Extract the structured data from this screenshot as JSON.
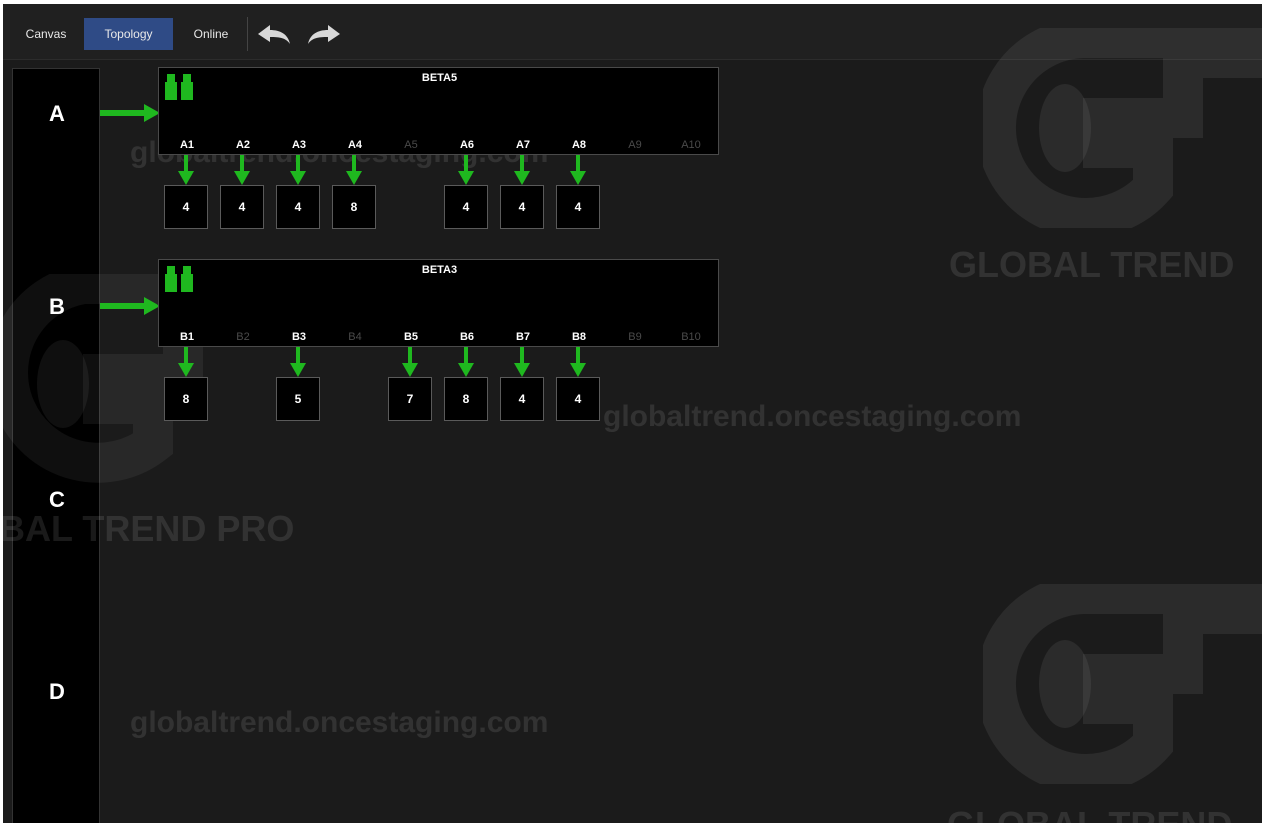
{
  "toolbar": {
    "tabs": [
      {
        "label": "Canvas",
        "active": false
      },
      {
        "label": "Topology",
        "active": true
      },
      {
        "label": "Online",
        "active": false
      }
    ],
    "undo_icon": "undo-arrow-icon",
    "redo_icon": "redo-arrow-icon"
  },
  "rail": {
    "labels": [
      "A",
      "B",
      "C",
      "D"
    ]
  },
  "devices": [
    {
      "name": "BETA5",
      "ports": [
        {
          "label": "A1",
          "active": true,
          "value": "4"
        },
        {
          "label": "A2",
          "active": true,
          "value": "4"
        },
        {
          "label": "A3",
          "active": true,
          "value": "4"
        },
        {
          "label": "A4",
          "active": true,
          "value": "8"
        },
        {
          "label": "A5",
          "active": false,
          "value": ""
        },
        {
          "label": "A6",
          "active": true,
          "value": "4"
        },
        {
          "label": "A7",
          "active": true,
          "value": "4"
        },
        {
          "label": "A8",
          "active": true,
          "value": "4"
        },
        {
          "label": "A9",
          "active": false,
          "value": ""
        },
        {
          "label": "A10",
          "active": false,
          "value": ""
        }
      ]
    },
    {
      "name": "BETA3",
      "ports": [
        {
          "label": "B1",
          "active": true,
          "value": "8"
        },
        {
          "label": "B2",
          "active": false,
          "value": ""
        },
        {
          "label": "B3",
          "active": true,
          "value": "5"
        },
        {
          "label": "B4",
          "active": false,
          "value": ""
        },
        {
          "label": "B5",
          "active": true,
          "value": "7"
        },
        {
          "label": "B6",
          "active": true,
          "value": "8"
        },
        {
          "label": "B7",
          "active": true,
          "value": "4"
        },
        {
          "label": "B8",
          "active": true,
          "value": "4"
        },
        {
          "label": "B9",
          "active": false,
          "value": ""
        },
        {
          "label": "B10",
          "active": false,
          "value": ""
        }
      ]
    }
  ],
  "watermarks": {
    "url": "globaltrend.oncestaging.com",
    "brand": "GLOBAL TREND",
    "brand_pro": "BAL TREND PRO"
  },
  "colors": {
    "accent_green": "#1fb81f",
    "active_tab": "#2f4b86",
    "background": "#1b1b1b"
  }
}
